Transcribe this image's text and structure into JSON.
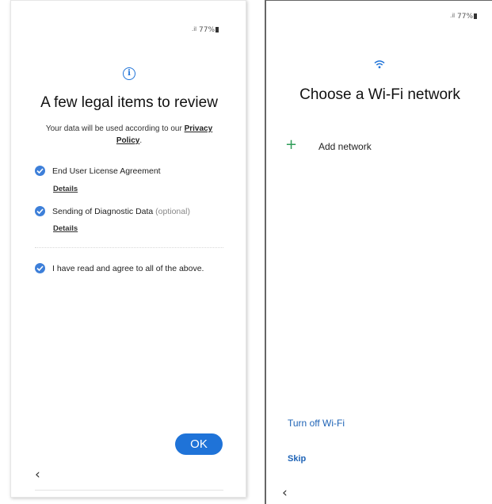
{
  "left_screen": {
    "status": {
      "signal": ".il",
      "battery": "77%"
    },
    "title": "A few legal items to review",
    "subtitle_prefix": "Your data will be used according to our ",
    "privacy_link": "Privacy Policy",
    "subtitle_suffix": ".",
    "items": [
      {
        "label": "End User License Agreement",
        "optional": "",
        "details": "Details",
        "checked": true
      },
      {
        "label": "Sending of Diagnostic Data ",
        "optional": "(optional)",
        "details": "Details",
        "checked": true
      }
    ],
    "agree_all": {
      "label": "I have read and agree to all of the above.",
      "checked": true
    },
    "ok_button": "OK",
    "back_glyph": "‹",
    "accent_color": "#1f73d8"
  },
  "right_screen": {
    "status": {
      "signal": ".il",
      "battery": "77%"
    },
    "title": "Choose a Wi-Fi network",
    "add_network": {
      "icon": "+",
      "label": "Add network"
    },
    "turn_off_wifi": "Turn off Wi-Fi",
    "skip": "Skip",
    "back_glyph": "‹",
    "link_color": "#1e63b6",
    "plus_color": "#2e9c57"
  }
}
